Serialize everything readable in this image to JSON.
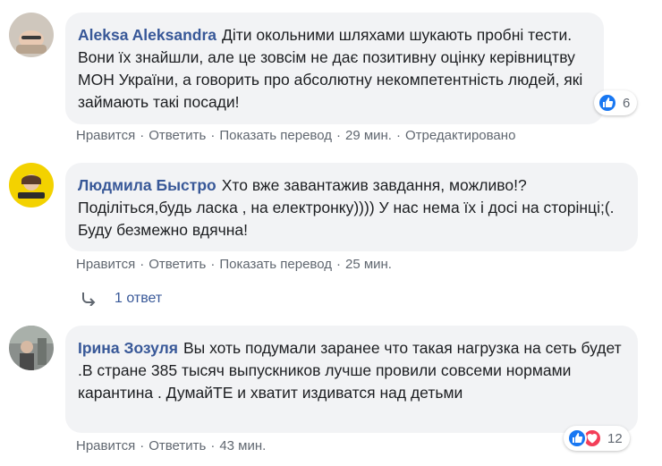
{
  "comments": [
    {
      "author": "Aleksa Aleksandra",
      "text": "Діти окольними шляхами шукають пробні тести. Вони їх знайшли, але це зовсім не дає позитивну оцінку керівництву МОН України, а говорить про абсолютну некомпетентність людей, які займають такі посади!",
      "actions": [
        "Нравится",
        "Ответить",
        "Показать перевод",
        "29 мин.",
        "Отредактировано"
      ],
      "reactions_count": "6"
    },
    {
      "author": "Людмила Быстро",
      "text": "Хто вже завантажив завдання, можливо!? Поділіться,будь ласка , на електронку)))) У нас нема їх і досі на сторінці;(. Буду безмежно вдячна!",
      "actions": [
        "Нравится",
        "Ответить",
        "Показать перевод",
        "25 мин."
      ],
      "replies_label": "1 ответ"
    },
    {
      "author": "Ірина Зозуля",
      "text": "Вы хоть подумали заранее что такая нагрузка на сеть будет .В стране 385 тысяч выпускников лучше провили совсеми нормами карантина . ДумайТЕ и хватит издиватся над детьми",
      "actions": [
        "Нравится",
        "Ответить",
        "43 мин."
      ],
      "reactions_count": "12"
    }
  ],
  "colors": {
    "author": "#385898",
    "bubble": "#f2f3f5",
    "meta": "#606770",
    "like": "#1877f2",
    "love": "#f33e58"
  },
  "icons": [
    "like-icon",
    "love-icon",
    "reply-arrow-icon"
  ]
}
